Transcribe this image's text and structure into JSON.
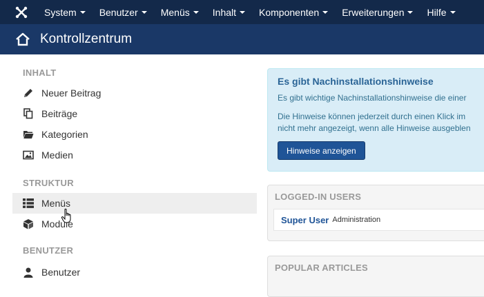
{
  "navbar": {
    "logo_icon": "joomla-logo-icon",
    "items": [
      {
        "label": "System"
      },
      {
        "label": "Benutzer"
      },
      {
        "label": "Menüs"
      },
      {
        "label": "Inhalt"
      },
      {
        "label": "Komponenten"
      },
      {
        "label": "Erweiterungen"
      },
      {
        "label": "Hilfe"
      }
    ]
  },
  "header": {
    "title": "Kontrollzentrum",
    "icon": "home-icon"
  },
  "sidebar": {
    "sections": [
      {
        "title": "INHALT",
        "items": [
          {
            "label": "Neuer Beitrag",
            "icon": "pencil-icon"
          },
          {
            "label": "Beiträge",
            "icon": "copy-icon"
          },
          {
            "label": "Kategorien",
            "icon": "folder-icon"
          },
          {
            "label": "Medien",
            "icon": "image-icon"
          }
        ]
      },
      {
        "title": "STRUKTUR",
        "items": [
          {
            "label": "Menüs",
            "icon": "list-icon",
            "active": true
          },
          {
            "label": "Module",
            "icon": "cube-icon"
          }
        ]
      },
      {
        "title": "BENUTZER",
        "items": [
          {
            "label": "Benutzer",
            "icon": "user-icon"
          }
        ]
      }
    ]
  },
  "alert": {
    "title": "Es gibt Nachinstallationshinweise",
    "line1": "Es gibt wichtige Nachinstallationshinweise die einer",
    "line2": "Die Hinweise können jederzeit durch einen Klick im",
    "line3": "nicht mehr angezeigt, wenn alle Hinweise ausgeblen",
    "button": "Hinweise anzeigen"
  },
  "logged_in": {
    "title": "LOGGED-IN USERS",
    "user": "Super User",
    "role": "Administration"
  },
  "popular": {
    "title": "POPULAR ARTICLES"
  },
  "colors": {
    "navbar": "#13294a",
    "header": "#1a3867",
    "accent": "#1f5497",
    "alert_bg": "#d9edf7"
  }
}
